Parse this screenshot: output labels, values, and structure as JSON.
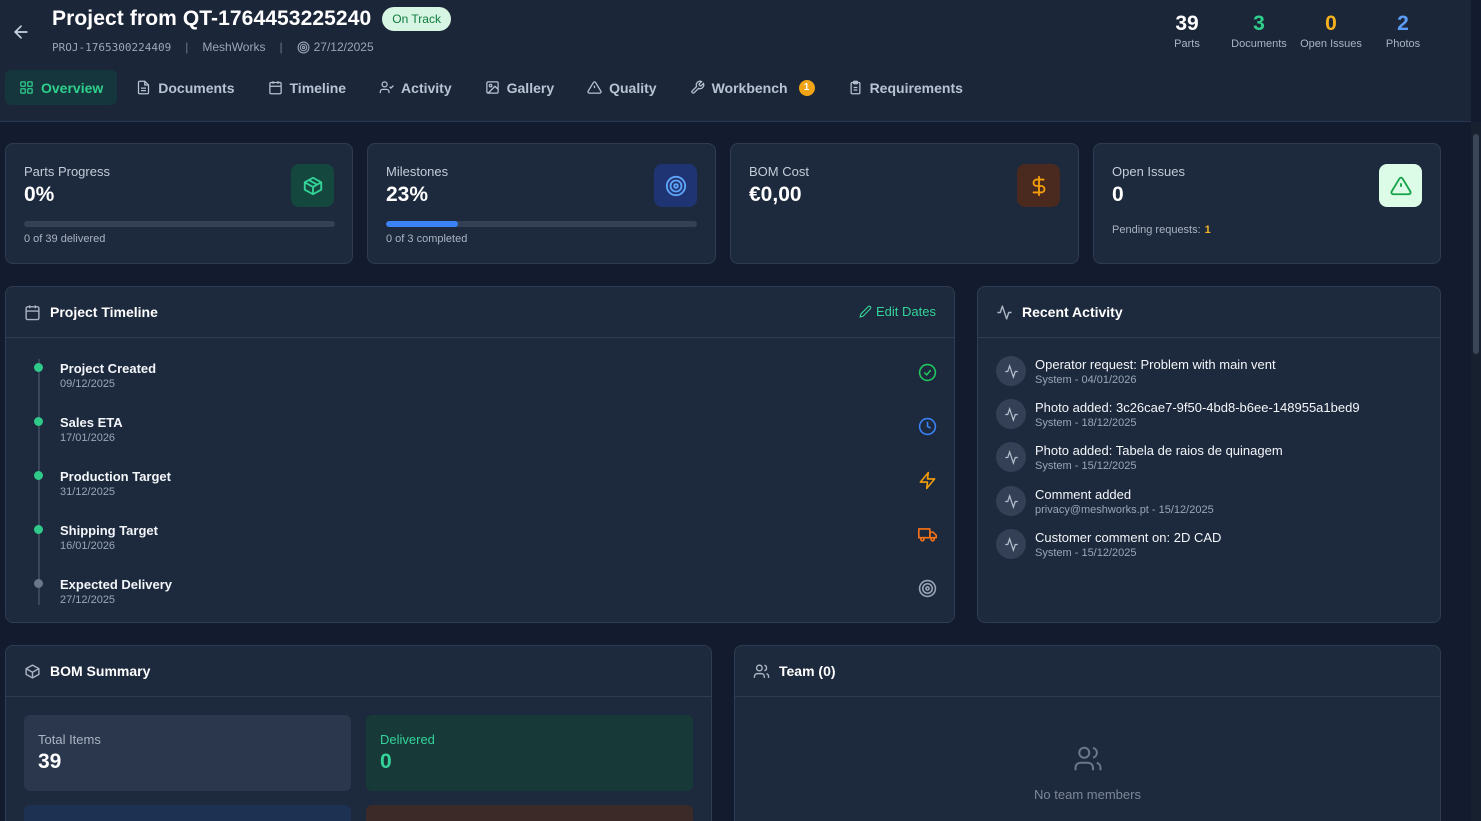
{
  "header": {
    "title": "Project from QT-1764453225240",
    "status": "On Track",
    "project_code": "PROJ-1765300224409",
    "company": "MeshWorks",
    "due_date": "27/12/2025",
    "separator": "|",
    "stats": [
      {
        "value": "39",
        "label": "Parts",
        "color": "#ffffff"
      },
      {
        "value": "3",
        "label": "Documents",
        "color": "#2fd08c"
      },
      {
        "value": "0",
        "label": "Open Issues",
        "color": "#f5b21c"
      },
      {
        "value": "2",
        "label": "Photos",
        "color": "#5b9cf6"
      }
    ]
  },
  "tabs": [
    {
      "label": "Overview",
      "icon": "grid-icon",
      "active": true
    },
    {
      "label": "Documents",
      "icon": "file-icon"
    },
    {
      "label": "Timeline",
      "icon": "calendar-icon"
    },
    {
      "label": "Activity",
      "icon": "users-icon"
    },
    {
      "label": "Gallery",
      "icon": "image-icon"
    },
    {
      "label": "Quality",
      "icon": "warning-icon"
    },
    {
      "label": "Workbench",
      "icon": "wrench-icon",
      "badge": "1"
    },
    {
      "label": "Requirements",
      "icon": "clipboard-icon"
    }
  ],
  "kpis": {
    "parts": {
      "label": "Parts Progress",
      "value": "0%",
      "progress": 0,
      "sub": "0 of 39 delivered",
      "icon": "box-icon"
    },
    "milestones": {
      "label": "Milestones",
      "value": "23%",
      "progress": 0.23,
      "sub": "0 of 3 completed",
      "icon": "target-icon"
    },
    "bom_cost": {
      "label": "BOM Cost",
      "value": "€0,00",
      "icon": "dollar-icon"
    },
    "issues": {
      "label": "Open Issues",
      "value": "0",
      "pending_label": "Pending requests:",
      "pending_value": "1",
      "icon": "alert-triangle-icon"
    }
  },
  "timeline": {
    "title": "Project Timeline",
    "edit_label": "Edit Dates",
    "items": [
      {
        "name": "Project Created",
        "date": "09/12/2025",
        "icon": "check-circle-icon",
        "color": "#22c55e"
      },
      {
        "name": "Sales ETA",
        "date": "17/01/2026",
        "icon": "clock-icon",
        "color": "#3b82f6"
      },
      {
        "name": "Production Target",
        "date": "31/12/2025",
        "icon": "zap-icon",
        "color": "#f59e0b"
      },
      {
        "name": "Shipping Target",
        "date": "16/01/2026",
        "icon": "truck-icon",
        "color": "#f97316"
      },
      {
        "name": "Expected Delivery",
        "date": "27/12/2025",
        "icon": "target-icon",
        "color": "#9aa6b8"
      }
    ]
  },
  "activity": {
    "title": "Recent Activity",
    "items": [
      {
        "text": "Operator request: Problem with main vent",
        "meta": "System - 04/01/2026"
      },
      {
        "text": "Photo added: 3c26cae7-9f50-4bd8-b6ee-148955a1bed9",
        "meta": "System - 18/12/2025"
      },
      {
        "text": "Photo added: Tabela de raios de quinagem",
        "meta": "System - 15/12/2025"
      },
      {
        "text": "Comment added",
        "meta": "privacy@meshworks.pt - 15/12/2025"
      },
      {
        "text": "Customer comment on: 2D CAD",
        "meta": "System - 15/12/2025"
      }
    ]
  },
  "bom": {
    "title": "BOM Summary",
    "total_label": "Total Items",
    "total_value": "39",
    "delivered_label": "Delivered",
    "delivered_value": "0"
  },
  "team": {
    "title": "Team (0)",
    "empty": "No team members"
  }
}
